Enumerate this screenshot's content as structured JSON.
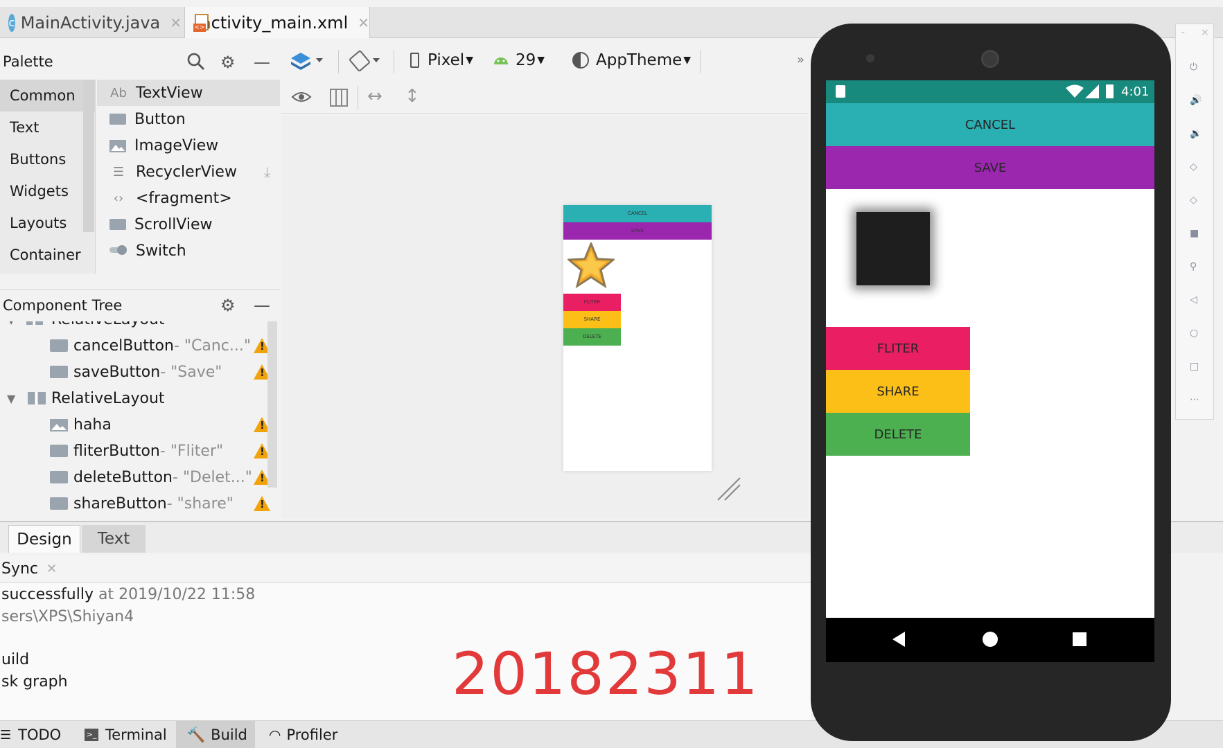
{
  "tabs": {
    "file1": "MainActivity.java",
    "file2": "activity_main.xml"
  },
  "palette": {
    "title": "Palette",
    "categories": [
      "Common",
      "Text",
      "Buttons",
      "Widgets",
      "Layouts",
      "Container"
    ],
    "items": [
      {
        "icon": "Ab",
        "label": "TextView"
      },
      {
        "icon": "",
        "label": "Button"
      },
      {
        "icon": "",
        "label": "ImageView"
      },
      {
        "icon": "",
        "label": "RecyclerView"
      },
      {
        "icon": "‹›",
        "label": "<fragment>"
      },
      {
        "icon": "",
        "label": "ScrollView"
      },
      {
        "icon": "",
        "label": "Switch"
      }
    ]
  },
  "toolbar": {
    "device": "Pixel",
    "api": "29",
    "theme": "AppTheme"
  },
  "tree": {
    "title": "Component Tree",
    "partial_top": "RelativeLayout",
    "rows": [
      {
        "name": "cancelButton",
        "sep": "- ",
        "hint": "\"Canc...\""
      },
      {
        "name": "saveButton",
        "sep": "- ",
        "hint": "\"Save\""
      },
      {
        "name": "RelativeLayout",
        "sep": "",
        "hint": ""
      },
      {
        "name": "haha",
        "sep": "",
        "hint": ""
      },
      {
        "name": "fliterButton",
        "sep": "- ",
        "hint": "\"Fliter\""
      },
      {
        "name": "deleteButton",
        "sep": "- ",
        "hint": "\"Delet...\""
      },
      {
        "name": "shareButton",
        "sep": "- ",
        "hint": "\"share\""
      }
    ]
  },
  "modes": {
    "design": "Design",
    "text": "Text"
  },
  "build": {
    "tab": "Sync",
    "line1_strong": "successfully",
    "line1_rest": " at 2019/10/22 11:58",
    "line2": "sers\\XPS\\Shiyan4",
    "line3": "uild",
    "line4": "sk graph",
    "watermark": "20182311"
  },
  "bottom": {
    "todo": "TODO",
    "terminal": "Terminal",
    "build": "Build",
    "profiler": "Profiler"
  },
  "app": {
    "time": "4:01",
    "cancel": "CANCEL",
    "save": "SAVE",
    "fliter": "FLITER",
    "share": "SHARE",
    "delete": "DELETE",
    "cancel_color": "#2ab0b3",
    "save_color": "#9b27ae",
    "fliter_color": "#e91e63",
    "share_color": "#fbbf18",
    "delete_color": "#4caf50"
  }
}
